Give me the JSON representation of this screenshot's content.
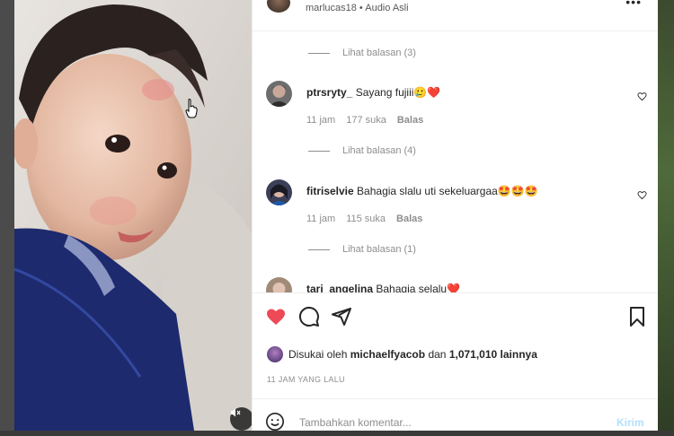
{
  "colors": {
    "like_red": "#ed4956",
    "text_primary": "#262626",
    "text_secondary": "#8e8e8e",
    "post_button_disabled": "#b2dffc"
  },
  "post_header": {
    "username": "marlucas18",
    "separator": "•",
    "audio": "Audio Asli",
    "more_icon": "more-horizontal-icon"
  },
  "comments": {
    "top_view_replies": "Lihat balasan (3)",
    "items": [
      {
        "username": "ptrsryty_",
        "text": "Sayang fujiii🥲❤️",
        "time": "11 jam",
        "likes": "177 suka",
        "reply": "Balas",
        "view_replies": "Lihat balasan (4)"
      },
      {
        "username": "fitriselvie",
        "text": "Bahagia slalu uti sekeluargaa🤩🤩🤩",
        "time": "11 jam",
        "likes": "115 suka",
        "reply": "Balas",
        "view_replies": "Lihat balasan (1)"
      },
      {
        "username": "tari_angelina",
        "text": "Bahagia selalu❤️"
      }
    ]
  },
  "actions": {
    "like_icon": "heart-filled-icon",
    "comment_icon": "comment-bubble-icon",
    "share_icon": "paper-plane-icon",
    "save_icon": "bookmark-icon"
  },
  "likes": {
    "prefix": "Disukai oleh",
    "user": "michaelfyacob",
    "middle": "dan",
    "count": "1,071,010 lainnya"
  },
  "time_ago": "11 JAM YANG LALU",
  "add_comment": {
    "placeholder": "Tambahkan komentar...",
    "post_label": "Kirim"
  },
  "media": {
    "mute_icon": "speaker-muted-icon"
  }
}
